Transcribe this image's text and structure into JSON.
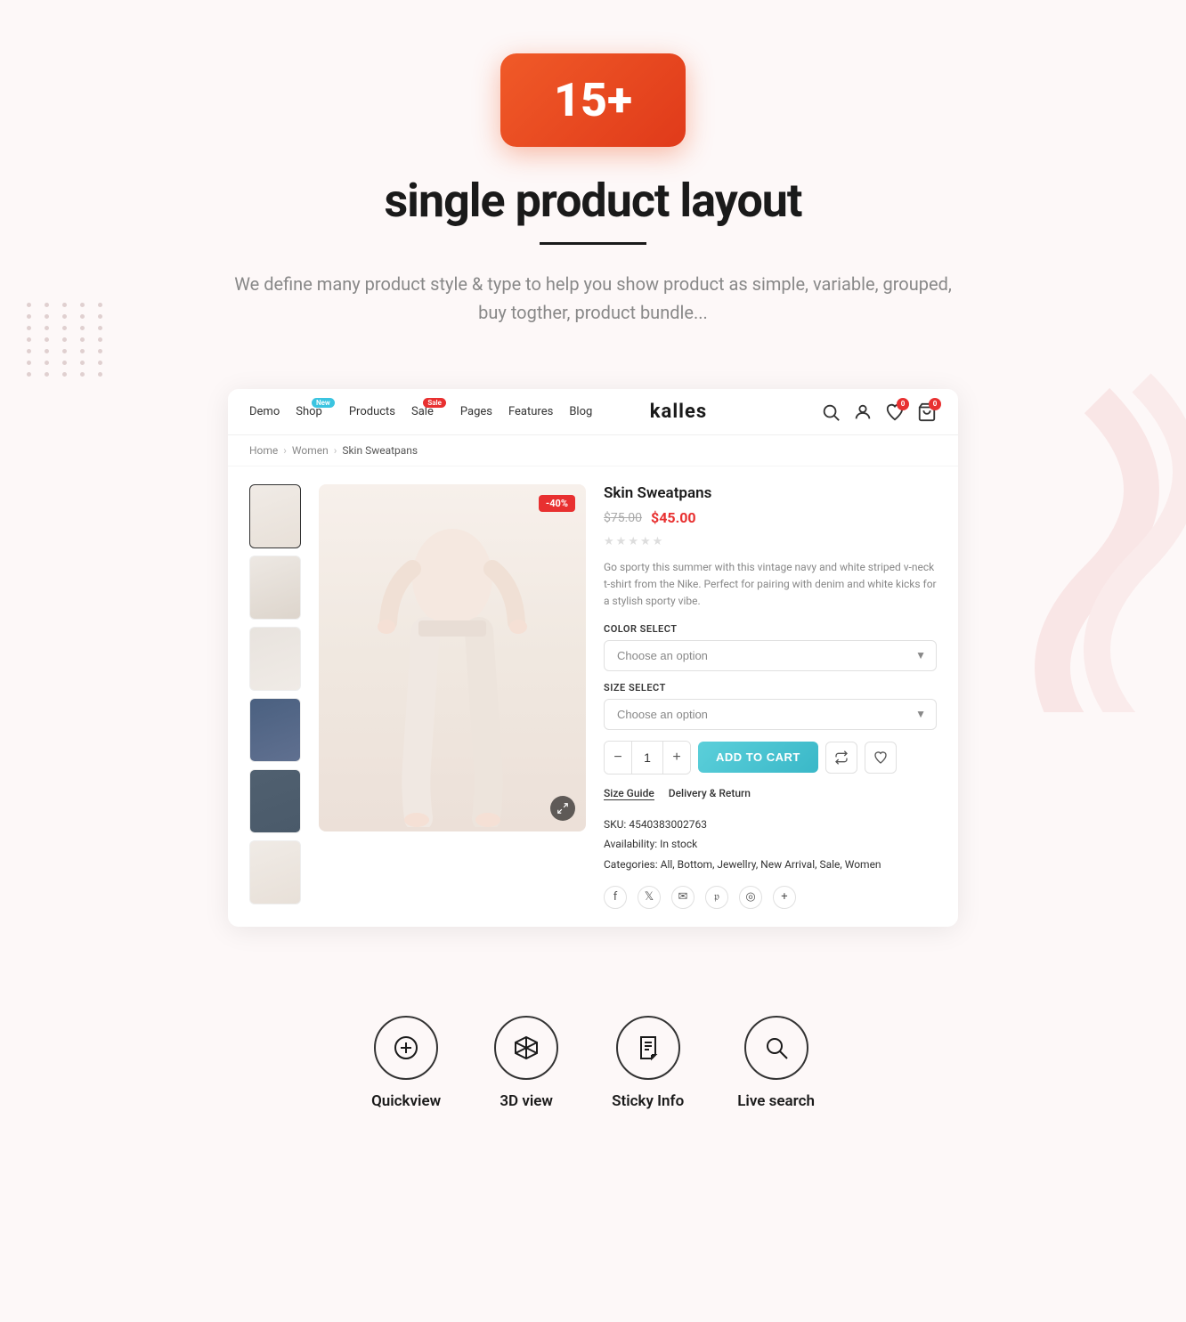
{
  "hero": {
    "counter": "15+",
    "title": "single product layout",
    "description": "We define many product style & type to help you show product as simple, variable, grouped, buy togther, product bundle..."
  },
  "navbar": {
    "links": [
      {
        "label": "Demo",
        "badge": null
      },
      {
        "label": "Shop",
        "badge": "New"
      },
      {
        "label": "Products",
        "badge": null
      },
      {
        "label": "Sale",
        "badge": "Sale"
      },
      {
        "label": "Pages",
        "badge": null
      },
      {
        "label": "Features",
        "badge": null
      },
      {
        "label": "Blog",
        "badge": null
      }
    ],
    "logo": "kalles",
    "cart_count": "0",
    "wishlist_count": "0"
  },
  "breadcrumb": {
    "items": [
      "Home",
      "Women",
      "Skin Sweatpans"
    ]
  },
  "product": {
    "title": "Skin Sweatpans",
    "price_old": "$75.00",
    "price_new": "$45.00",
    "sale_badge": "-40%",
    "description": "Go sporty this summer with this vintage navy and white striped v-neck t-shirt from the Nike. Perfect for pairing with denim and white kicks for a stylish sporty vibe.",
    "color_label": "COLOR SELECT",
    "color_placeholder": "Choose an option",
    "size_label": "SIZE SELECT",
    "size_placeholder": "Choose an option",
    "qty": "1",
    "add_to_cart": "ADD TO CART",
    "size_guide": "Size Guide",
    "delivery_return": "Delivery & Return",
    "sku_label": "SKU:",
    "sku_value": "4540383002763",
    "availability_label": "Availability:",
    "availability_value": "In stock",
    "categories_label": "Categories:",
    "categories_value": "All, Bottom, Jewellry, New Arrival, Sale, Women"
  },
  "features": [
    {
      "icon": "quickview-icon",
      "icon_char": "⊕",
      "label": "Quickview"
    },
    {
      "icon": "3d-view-icon",
      "icon_char": "⬡",
      "label": "3D view"
    },
    {
      "icon": "sticky-info-icon",
      "icon_char": "🔖",
      "label": "Sticky Info"
    },
    {
      "icon": "live-search-icon",
      "icon_char": "⌕",
      "label": "Live search"
    }
  ]
}
